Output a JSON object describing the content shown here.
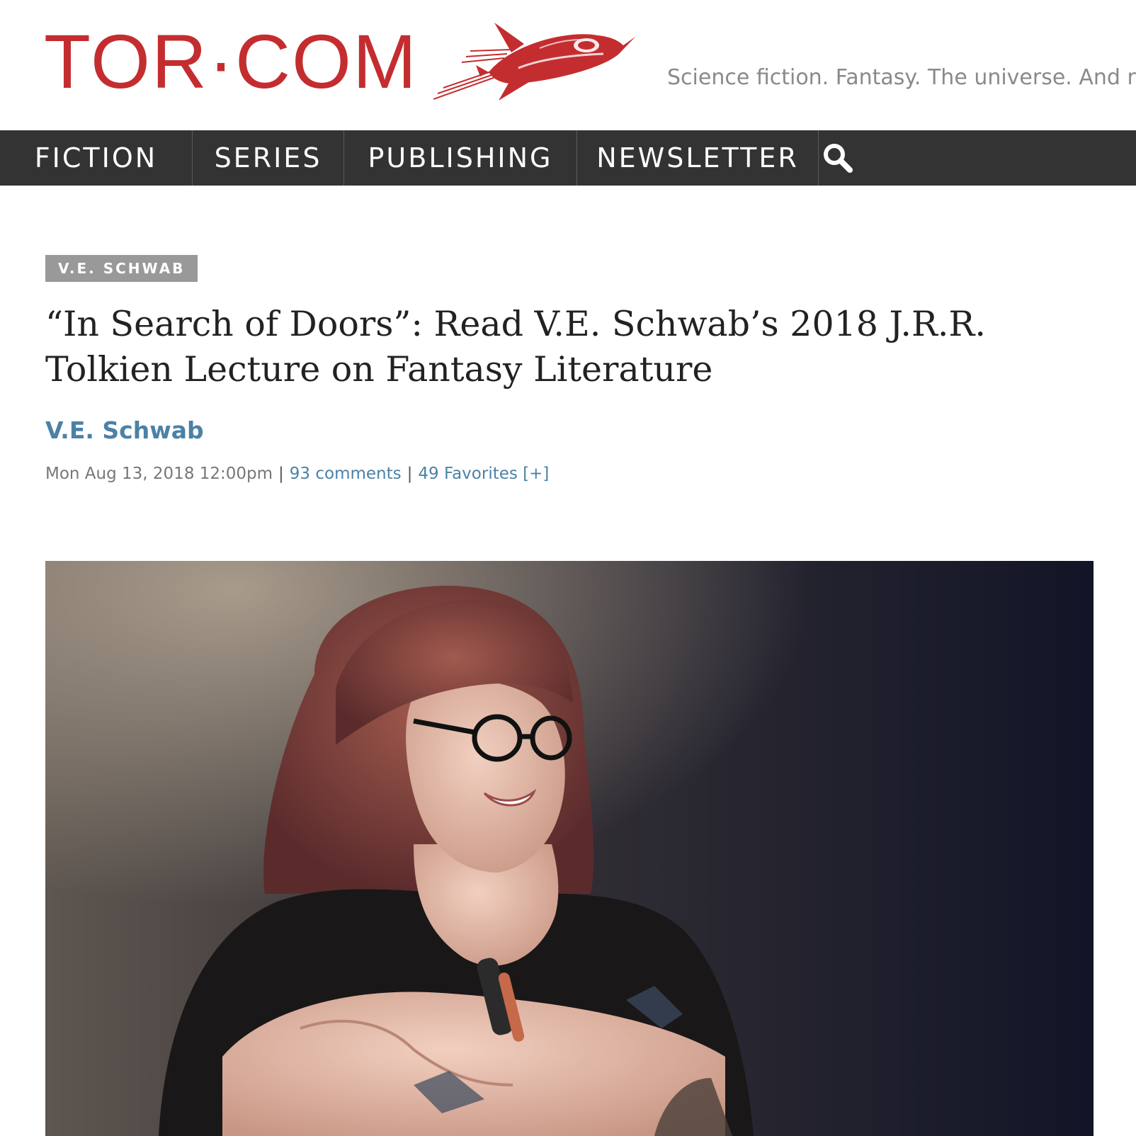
{
  "header": {
    "logo_text": "TOR·COM",
    "logo_icon": "rocket-icon",
    "tagline": "Science fiction. Fantasy. The universe. And re"
  },
  "nav": {
    "items": [
      {
        "label": "FICTION"
      },
      {
        "label": "SERIES"
      },
      {
        "label": "PUBLISHING"
      },
      {
        "label": "NEWSLETTER"
      }
    ],
    "search_icon": "search-icon"
  },
  "article": {
    "tag": "V.E. SCHWAB",
    "title": "“In Search of Doors”: Read V.E. Schwab’s 2018 J.R.R. Tolkien Lecture on Fantasy Literature",
    "author": "V.E. Schwab",
    "date": "Mon Aug 13, 2018 12:00pm",
    "separator": "|",
    "comments": "93 comments",
    "favorites": "49 Favorites [+]"
  },
  "colors": {
    "brand_red": "#c42d2f",
    "nav_bg": "#333333",
    "link_blue": "#4c81a6",
    "tag_gray": "#999999"
  }
}
